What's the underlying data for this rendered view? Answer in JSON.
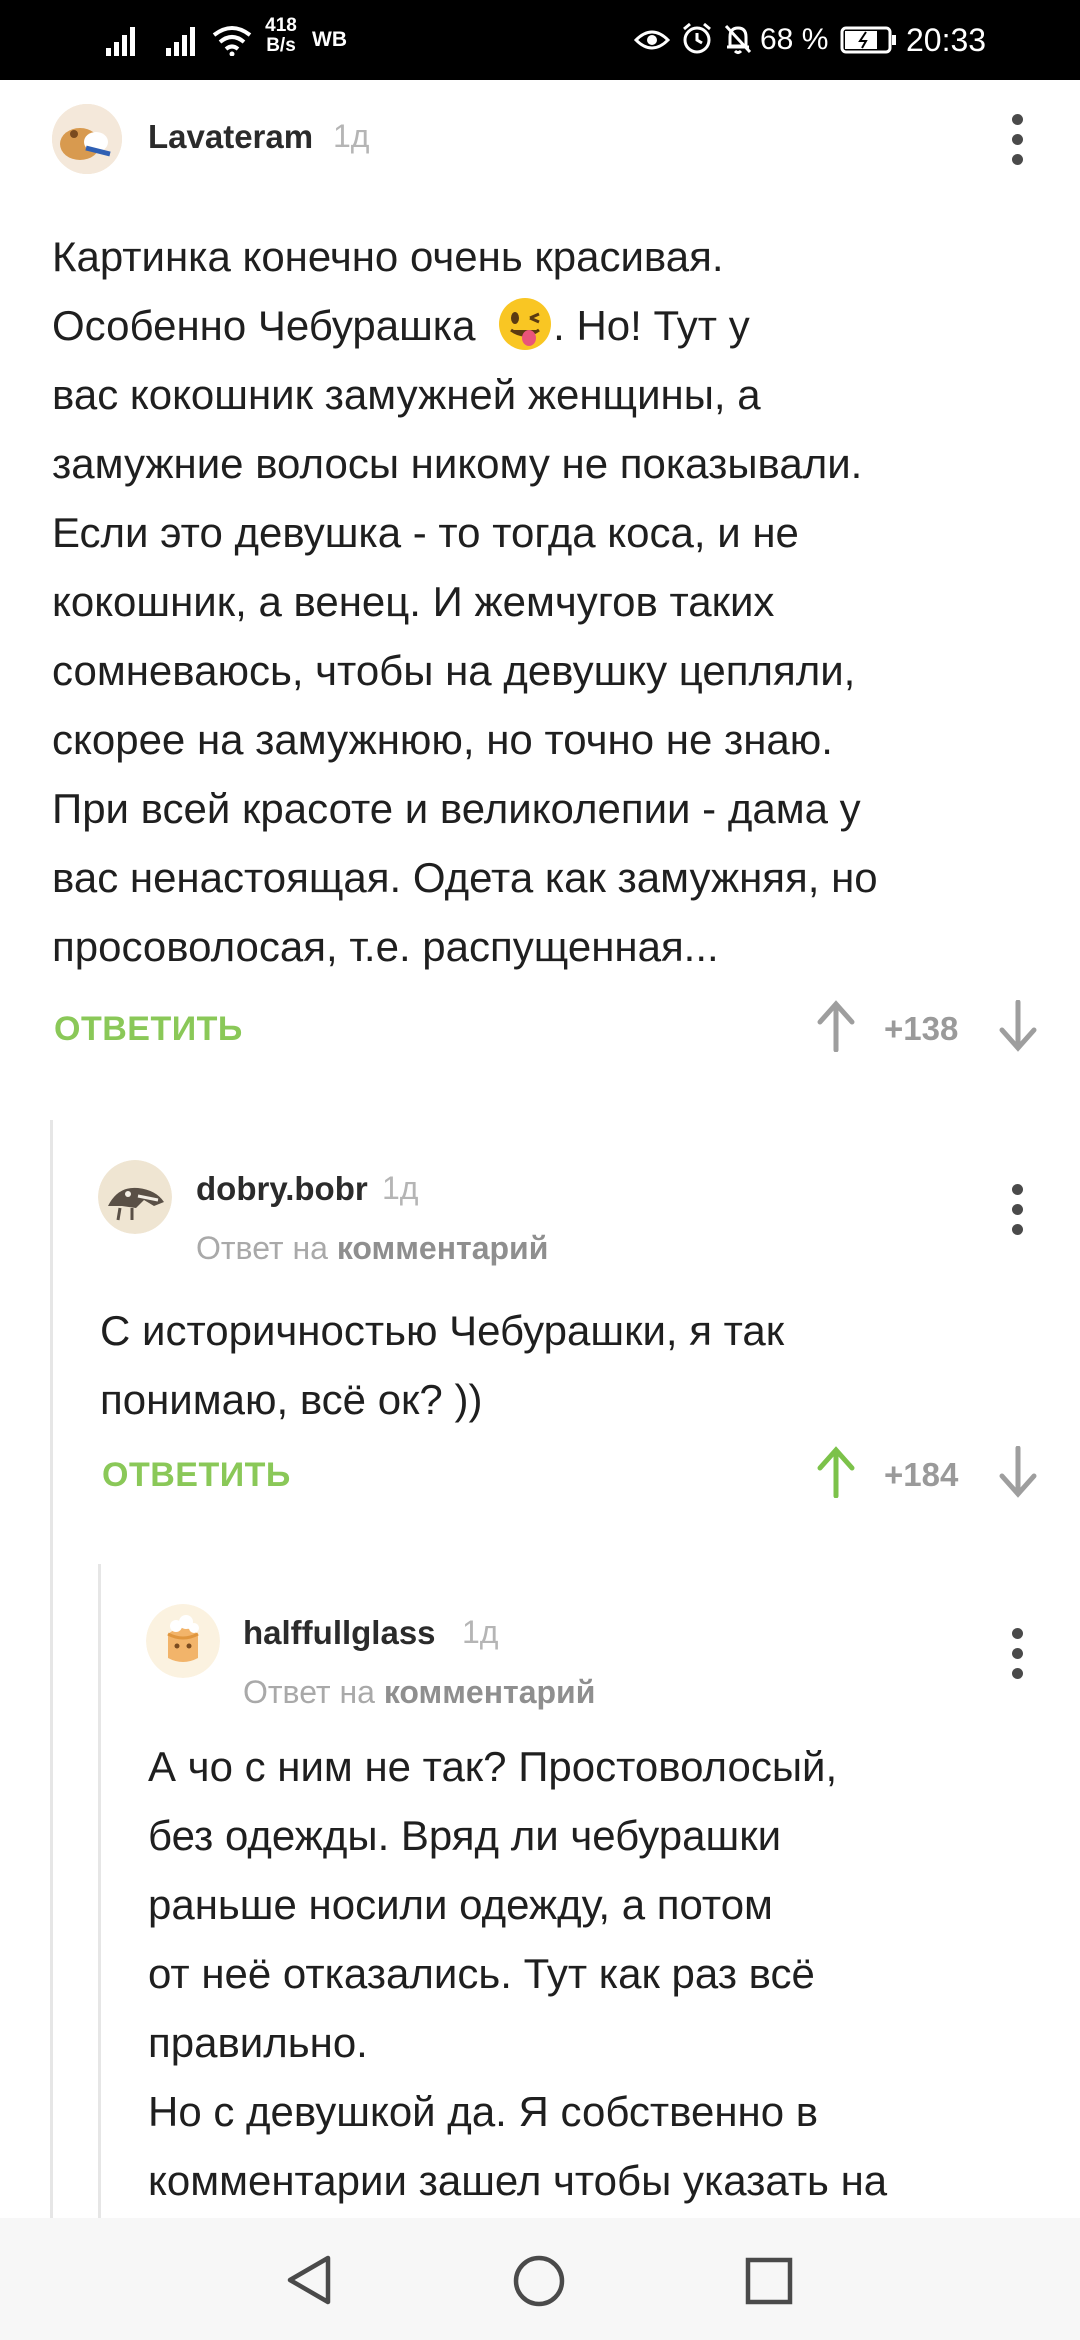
{
  "status_bar": {
    "net_speed_value": "418",
    "net_speed_unit": "B/s",
    "carrier_tag": "WB",
    "battery_percent": "68 %",
    "time": "20:33",
    "icons": [
      "signal-icon",
      "signal-icon",
      "wifi-icon",
      "eye-icon",
      "alarm-icon",
      "bell-off-icon",
      "battery-icon"
    ]
  },
  "comments": [
    {
      "author": "Lavateram",
      "time": "1д",
      "body_lines": [
        "Картинка конечно очень красивая.",
        "Особенно Чебурашка",
        ". Но! Тут у",
        "вас кокошник замужней женщины, а",
        "замужние волосы никому не показывали.",
        "Если это девушка - то тогда коса, и не",
        "кокошник, а венец. И жемчугов таких",
        "сомневаюсь, чтобы на девушку цепляли,",
        "скорее на замужнюю, но точно не знаю.",
        "При всей красоте и великолепии - дама у",
        "вас ненастоящая. Одета как замужняя, но",
        "просоволосая, т.е. распущенная..."
      ],
      "reply_label": "ОТВЕТИТЬ",
      "rating": "+138",
      "upvoted": false
    },
    {
      "author": "dobry.bobr",
      "time": "1д",
      "reply_prefix": "Ответ на",
      "reply_target": "комментарий",
      "body_lines": [
        "С историчностью Чебурашки, я так",
        "понимаю, всё ок? ))"
      ],
      "reply_label": "ОТВЕТИТЬ",
      "rating": "+184",
      "upvoted": true
    },
    {
      "author": "halffullglass",
      "time": "1д",
      "reply_prefix": "Ответ на",
      "reply_target": "комментарий",
      "body_lines": [
        "А чо с ним не так? Простоволосый,",
        "без одежды. Вряд ли чебурашки",
        "раньше носили одежду, а потом",
        "от неё отказались. Тут как раз всё",
        "правильно.",
        "Но с девушкой да. Я собственно в",
        "комментарии зашел чтобы указать на"
      ]
    }
  ],
  "colors": {
    "accent_green": "#8ac858",
    "upvote_active": "#7cc24a",
    "arrow_inactive": "#9e9e9e"
  },
  "nav_bar": {
    "icons": [
      "back-icon",
      "home-icon",
      "recents-icon"
    ]
  }
}
